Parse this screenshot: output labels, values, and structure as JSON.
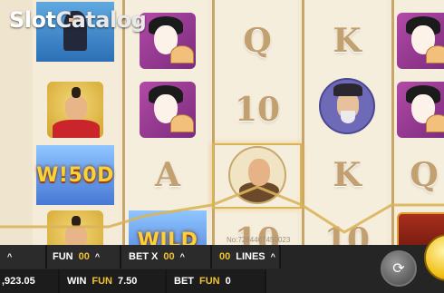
{
  "logo": {
    "part1": "Slot",
    "part2": "Catalog"
  },
  "reels": {
    "reel0": [
      {
        "type": "ninja",
        "name": "ninja"
      },
      {
        "type": "samurai",
        "name": "samurai"
      },
      {
        "type": "wild",
        "text": "W!50D"
      },
      {
        "type": "samurai",
        "name": "samurai"
      }
    ],
    "reel1": [
      {
        "type": "geisha",
        "name": "geisha"
      },
      {
        "type": "geisha",
        "name": "geisha"
      },
      {
        "type": "card",
        "text": "A"
      },
      {
        "type": "wild",
        "text": "WILD"
      }
    ],
    "reel2": [
      {
        "type": "card",
        "text": "Q"
      },
      {
        "type": "card",
        "text": "10"
      },
      {
        "type": "old-man",
        "name": "old man"
      },
      {
        "type": "card",
        "text": "10"
      }
    ],
    "reel3": [
      {
        "type": "card",
        "text": "K"
      },
      {
        "type": "monk",
        "name": "monk"
      },
      {
        "type": "card",
        "text": "K"
      },
      {
        "type": "card",
        "text": "10"
      }
    ],
    "reel4": [
      {
        "type": "geisha",
        "name": "geisha"
      },
      {
        "type": "geisha",
        "name": "geisha"
      },
      {
        "type": "card",
        "text": "Q"
      },
      {
        "type": "chest",
        "name": "chest"
      }
    ]
  },
  "watermark": "No:7284467450023",
  "bar": {
    "fun_label": "FUN",
    "fun_value": "00",
    "bet_x_label": "BET X",
    "bet_x_value": "00",
    "lines_value": "00",
    "lines_label": "LINES",
    "balance": ",923.05",
    "win_label": "WIN",
    "win_currency": "FUN",
    "win_value": "7.50",
    "bet_label": "BET",
    "bet_currency": "FUN",
    "bet_value": "0"
  },
  "icons": {
    "auto": "autoplay-icon",
    "spin": "spin-icon",
    "caret": "^"
  },
  "colors": {
    "accent_gold": "#f2c230",
    "frame_gold": "#d9b45b",
    "bar_bg": "#252525"
  }
}
